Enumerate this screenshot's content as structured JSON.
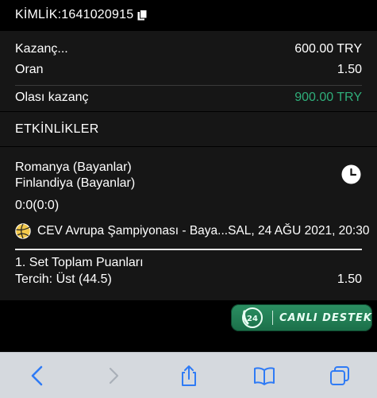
{
  "header": {
    "id_label": "KİMLİK:1641020915",
    "copy_icon": "copy-icon"
  },
  "summary": {
    "rows": [
      {
        "label": "Kazanç...",
        "value": "600.00 TRY"
      },
      {
        "label": "Oran",
        "value": "1.50"
      },
      {
        "label": "Olası kazanç",
        "value": "900.00 TRY",
        "value_color": "#2fae7a"
      }
    ]
  },
  "events": {
    "title": "ETKİNLİKLER",
    "home_team": "Romanya (Bayanlar)",
    "away_team": "Finlandiya (Bayanlar)",
    "score": "0:0(0:0)",
    "competition": "CEV Avrupa Şampiyonası - Baya...",
    "datetime": "SAL, 24 AĞU 2021, 20:30",
    "market": "1. Set Toplam Puanları",
    "pick": "Tercih: Üst (44.5)",
    "odds": "1.50",
    "icons": {
      "clock": "clock-icon",
      "sport": "volleyball-icon"
    }
  },
  "live_support": {
    "badge": "24",
    "label": "CANLI DESTEK"
  },
  "toolbar": {
    "items": [
      "back-icon",
      "forward-icon",
      "share-icon",
      "bookmarks-icon",
      "tabs-icon"
    ]
  },
  "colors": {
    "accent_green": "#2fae7a",
    "toolbar_bg": "#d5d9de",
    "toolbar_icon": "#2f7bf5"
  }
}
